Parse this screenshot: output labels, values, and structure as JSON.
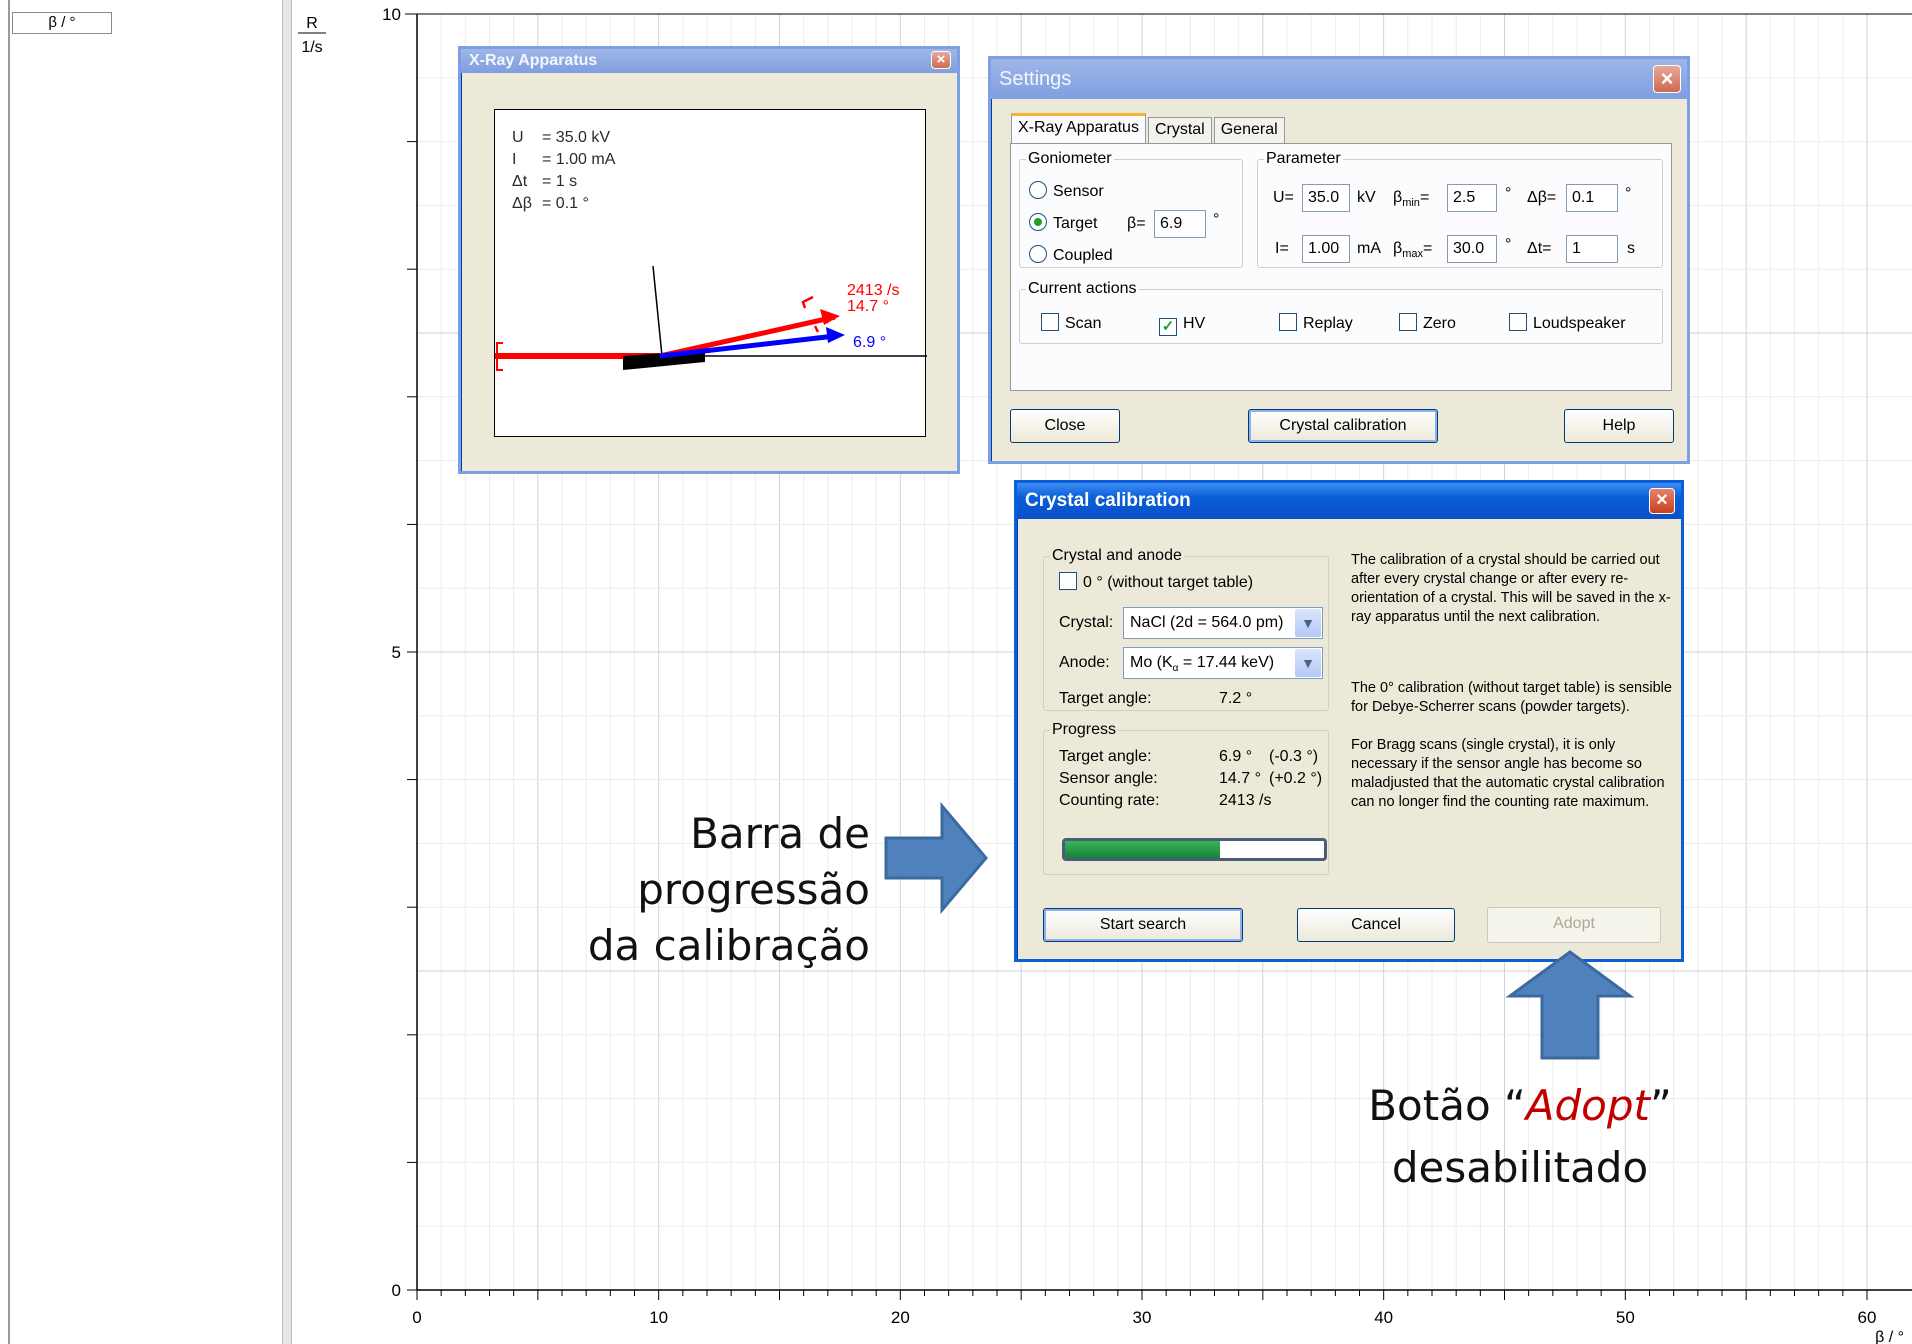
{
  "left_panel": {
    "column_header": "β / °"
  },
  "chart_data": {
    "type": "line",
    "y_unit_top": "R",
    "y_unit_bottom": "1/s",
    "x_unit": "β / °",
    "x_ticks": [
      0,
      10,
      20,
      30,
      40,
      50,
      60
    ],
    "y_ticks": [
      0,
      5,
      10
    ],
    "xlim": [
      0,
      60
    ],
    "ylim": [
      0,
      10
    ],
    "grid": true,
    "series": []
  },
  "xray_window": {
    "title": "X-Ray Apparatus",
    "close_label": "×",
    "params": [
      {
        "name": "U",
        "value": "= 35.0 kV"
      },
      {
        "name": "I",
        "value": "= 1.00 mA"
      },
      {
        "name": "Δt",
        "value": "= 1 s"
      },
      {
        "name": "Δβ",
        "value": "= 0.1 °"
      }
    ],
    "sensor_rate": "2413 /s",
    "sensor_angle": "14.7 °",
    "target_angle": "6.9 °",
    "colors": {
      "beam": "#ff0000",
      "target_beam": "#0000ff"
    }
  },
  "settings": {
    "title": "Settings",
    "close_label": "×",
    "tabs": [
      "X-Ray Apparatus",
      "Crystal",
      "General"
    ],
    "goniometer": {
      "legend": "Goniometer",
      "options": [
        "Sensor",
        "Target",
        "Coupled"
      ],
      "selected": "Target",
      "beta_label": "β=",
      "beta_value": "6.9",
      "beta_unit": "°"
    },
    "parameter": {
      "legend": "Parameter",
      "u_label": "U=",
      "u_value": "35.0",
      "u_unit": "kV",
      "i_label": "I=",
      "i_value": "1.00",
      "i_unit": "mA",
      "bmin_label": "β",
      "bmin_sub": "min",
      "bmin_eq": "=",
      "bmin_value": "2.5",
      "bmin_unit": "°",
      "bmax_label": "β",
      "bmax_sub": "max",
      "bmax_eq": "=",
      "bmax_value": "30.0",
      "bmax_unit": "°",
      "db_label": "Δβ=",
      "db_value": "0.1",
      "db_unit": "°",
      "dt_label": "Δt=",
      "dt_value": "1",
      "dt_unit": "s"
    },
    "actions": {
      "legend": "Current actions",
      "items": [
        {
          "label": "Scan",
          "checked": false,
          "mark": ""
        },
        {
          "label": "HV",
          "checked": true,
          "mark": "✓"
        },
        {
          "label": "Replay",
          "checked": false,
          "mark": ""
        },
        {
          "label": "Zero",
          "checked": false,
          "mark": ""
        },
        {
          "label": "Loudspeaker",
          "checked": false,
          "mark": ""
        }
      ]
    },
    "buttons": {
      "close": "Close",
      "calibration": "Crystal calibration",
      "help": "Help"
    }
  },
  "calibration": {
    "title": "Crystal calibration",
    "close_label": "×",
    "crystal_anode": {
      "legend": "Crystal and anode",
      "zero_option": "0 ° (without target table)",
      "crystal_label": "Crystal:",
      "crystal_value": "NaCl (2d = 564.0 pm)",
      "anode_label": "Anode:",
      "anode_value_pre": "Mo (K",
      "anode_value_sub": "α",
      "anode_value_post": " = 17.44 keV)",
      "target_angle_label": "Target angle:",
      "target_angle_value": "7.2 °"
    },
    "progress": {
      "legend": "Progress",
      "target_label": "Target angle:",
      "target_value": "6.9 °",
      "target_delta": "(-0.3 °)",
      "sensor_label": "Sensor angle:",
      "sensor_value": "14.7 °",
      "sensor_delta": "(+0.2 °)",
      "rate_label": "Counting rate:",
      "rate_value": "2413 /s",
      "progress_fraction": 0.6
    },
    "info_1": "The calibration of a crystal should be carried out after every crystal change or after every re-orientation of a crystal. This will be saved in the x-ray apparatus until the next calibration.",
    "info_2": "The 0° calibration (without target table) is sensible for Debye-Scherrer scans (powder targets).",
    "info_3": "For Bragg scans (single crystal), it is only necessary if the sensor angle has become so maladjusted that the automatic crystal calibration can no longer find the counting rate maximum.",
    "buttons": {
      "start": "Start search",
      "cancel": "Cancel",
      "adopt": "Adopt"
    },
    "adopt_enabled": false
  },
  "annotations": {
    "progress_line1": "Barra de progressão",
    "progress_line2": "da calibração",
    "adopt_pre": "Botão “",
    "adopt_word": "Adopt",
    "adopt_post": "”",
    "adopt_line2": "desabilitado",
    "arrow_color": "#4f81bd"
  }
}
